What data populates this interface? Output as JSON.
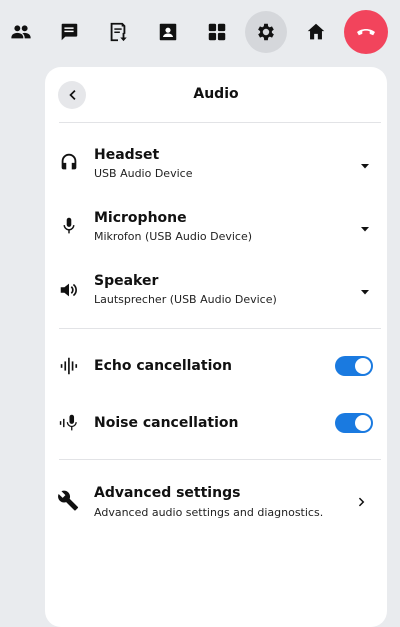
{
  "toolbar": {
    "buttons": [
      {
        "name": "participants",
        "icon": "people-icon"
      },
      {
        "name": "chat",
        "icon": "chat-icon"
      },
      {
        "name": "whiteboard",
        "icon": "download-doc-icon"
      },
      {
        "name": "contacts",
        "icon": "contact-icon"
      },
      {
        "name": "apps",
        "icon": "grid-icon"
      },
      {
        "name": "settings",
        "icon": "gear-icon",
        "active": true
      },
      {
        "name": "home",
        "icon": "home-icon"
      },
      {
        "name": "hang-up",
        "icon": "phone-hangup-icon",
        "color": "#f2445c"
      }
    ]
  },
  "panel": {
    "title": "Audio",
    "devices": [
      {
        "title": "Headset",
        "subtitle": "USB Audio Device",
        "icon": "headset-icon"
      },
      {
        "title": "Microphone",
        "subtitle": "Mikrofon (USB Audio Device)",
        "icon": "microphone-icon"
      },
      {
        "title": "Speaker",
        "subtitle": "Lautsprecher (USB Audio Device)",
        "icon": "speaker-icon"
      }
    ],
    "toggles": [
      {
        "title": "Echo cancellation",
        "icon": "echo-cancellation-icon",
        "on": true
      },
      {
        "title": "Noise cancellation",
        "icon": "noise-cancellation-icon",
        "on": true
      }
    ],
    "advanced": {
      "title": "Advanced settings",
      "subtitle": "Advanced audio settings and diagnostics.",
      "icon": "wrench-icon"
    }
  },
  "colors": {
    "accent": "#1a7ae0",
    "hangup": "#f2445c",
    "background": "#e9ebee",
    "active_button": "#d5d7db"
  }
}
